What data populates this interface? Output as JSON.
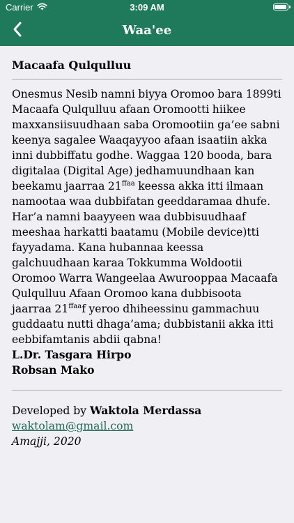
{
  "status_bar": {
    "carrier": "Carrier",
    "time": "3:09 AM",
    "battery_level": 1.0
  },
  "nav": {
    "title": "Waa'ee",
    "back_icon": "chevron-left-icon"
  },
  "colors": {
    "brand": "#1f7a5c",
    "background": "#efeff4",
    "link": "#1f6b52"
  },
  "about": {
    "heading": "Macaafa Qulqulluu",
    "para_part1": "Onesmus Nesib namni biyya Oromoo bara 1899ti Macaafa Qulqulluu afaan Oromootti hiikee maxxansiisuudhaan saba Oromootiin ga’ee sabni keenya sagalee Waaqayyoo afaan isaatiin akka inni dubbiffatu godhe. Waggaa 120 booda, bara digitalaa (Digital Age) jedhamuundhaan kan beekamu jaarraa 21",
    "sup1": "ffaa",
    "para_part2": " keessa akka itti ilmaan namootaa waa dubbifatan geeddaramaa dhufe. Har’a namni baayyeen waa dubbisuudhaaf meeshaa harkatti baatamu (Mobile device)tti fayyadama. Kana hubannaa keessa galchuudhaan karaa Tokkumma Woldootii Oromoo Warra Wangeelaa Awurooppaa Macaafa Qulqulluu Afaan Oromoo kana dubbisoota jaarraa 21",
    "sup2": "ffaa",
    "para_part3": "f yeroo dhiheessinu gammachuu guddaatu nutti dhaga’ama; dubbistanii akka itti eebbifamtanis abdii qabna!",
    "author1": "L.Dr. Tasgara Hirpo",
    "author2": "Robsan Mako"
  },
  "credits": {
    "developed_by_label": "Developed by ",
    "developer": "Waktola Merdassa",
    "email": "waktolam@gmail.com",
    "place_date": "Amajji, 2020"
  }
}
